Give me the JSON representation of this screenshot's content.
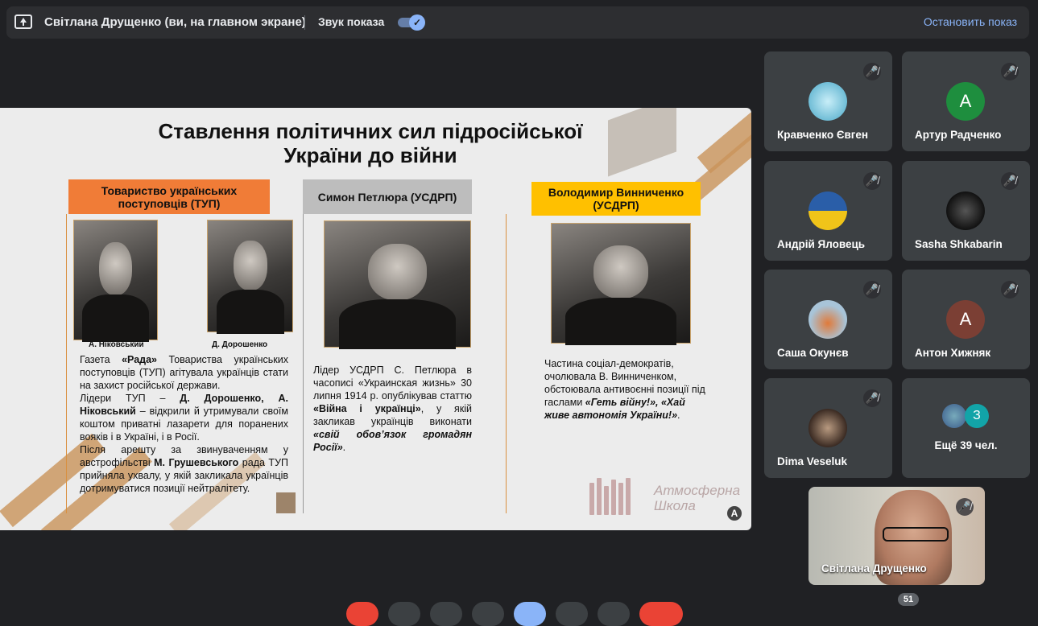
{
  "topbar": {
    "presenter": "Світлана Друщенко (ви, на главном экране)",
    "sound_label": "Звук показа",
    "stop_label": "Остановить показ"
  },
  "slide": {
    "title_line1": "Ставлення політичних сил підросійської",
    "title_line2": "України до війни",
    "col1": {
      "heading": "Товариство українських поступовців (ТУП)",
      "heading_color": "#f07c37",
      "caption1": "А. Ніковський",
      "caption2": "Д. Дорошенко",
      "p1_a": "Газета ",
      "p1_b": "«Рада»",
      "p1_c": " Товариства українських поступовців (ТУП) агітувала українців стати на захист російської держави.",
      "p2_a": "Лідери ТУП – ",
      "p2_b": "Д. Дорошенко, А. Ніковський",
      "p2_c": " – відкрили й утримували своїм коштом приватні лазарети для поранених вояків і в Україні, і в Росії.",
      "p3_a": "Після арешту за звинуваченням у австрофільстві ",
      "p3_b": "М. Грушевського",
      "p3_c": " рада ТУП прийняла ухвалу, у якій закликала українців дотримуватися позиції нейтралітету."
    },
    "col2": {
      "heading": "Симон Петлюра (УСДРП)",
      "heading_color": "#bdbdbd",
      "p_a": "Лідер УСДРП С. Петлюра в часописі «Украинская жизнь» 30 липня 1914 р. опублікував статтю ",
      "p_b": "«Війна і українці»",
      "p_c": ", у якій закликав українців виконати ",
      "p_d": "«свій обов’язок громадян Росії»",
      "p_e": "."
    },
    "col3": {
      "heading": "Володимир Винниченко (УСДРП)",
      "heading_color": "#ffc000",
      "p_a": "Частина соціал-демократів, очолювала В. Винниченком, обстоювала антивоєнні позиції під гаслами ",
      "p_b": "«Геть війну!», «Хай живе автономія України!»",
      "p_c": "."
    },
    "logo_line1": "Атмосферна",
    "logo_line2": "Школа",
    "corner_mark": "A"
  },
  "participants": [
    {
      "name": "Кравченко Євген",
      "initial": "",
      "avatar_color": "#6fb8d6"
    },
    {
      "name": "Артур Радченко",
      "initial": "A",
      "avatar_color": "#1e8e3e"
    },
    {
      "name": "Андрій Яловець",
      "initial": "",
      "avatar_color": "#2a5ea8"
    },
    {
      "name": "Sasha Shkabarin",
      "initial": "",
      "avatar_color": "#111111"
    },
    {
      "name": "Саша Окунєв",
      "initial": "",
      "avatar_color": "#a8c4d8"
    },
    {
      "name": "Антон Хижняк",
      "initial": "A",
      "avatar_color": "#7b3f34"
    },
    {
      "name": "Dima Veseluk",
      "initial": "",
      "avatar_color": "#4a3a32"
    }
  ],
  "more": {
    "initial": "З",
    "label": "Ещё 39 чел."
  },
  "self_view": {
    "name": "Світлана Друщенко"
  },
  "participant_count": "51",
  "icons": {
    "mic_off": "mic-off-icon",
    "present": "present-to-all-icon"
  }
}
